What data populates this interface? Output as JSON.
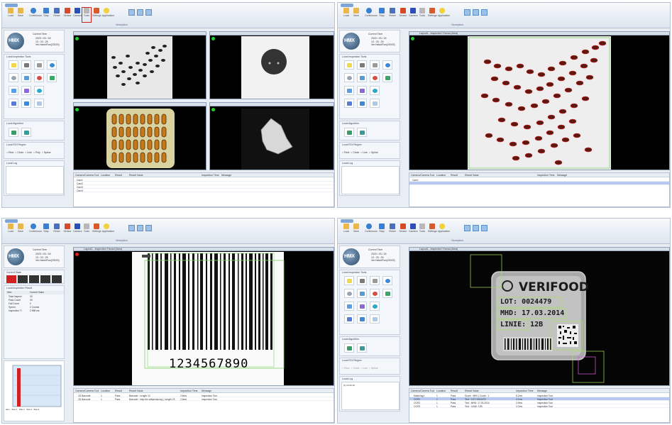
{
  "ribbon": {
    "buttons": [
      "Load",
      "Save",
      "Continuous",
      "Stop",
      "Reset",
      "Sensor",
      "Camera",
      "Tools",
      "Settings",
      "Light",
      "Application"
    ],
    "group_label": "Viewoption",
    "layout_labels": "Vertical  Horizontal  Splitter"
  },
  "panel": {
    "logo": "HMX",
    "time_label": "Current Time",
    "time_values": [
      "2020 / 03 / 18",
      "13 : 33 : 25",
      "Ver.HatchRun(20023)"
    ],
    "inspection_tools": "Local Inspection Tools",
    "algorithm": "Local Algorithm",
    "roi_region": "Local ROI Region",
    "roi_options": [
      "Rect",
      "Circle",
      "Line",
      "Poly",
      "Spline"
    ],
    "log": "Local Log",
    "log_entry": "[1] 13:33:18"
  },
  "w3panel": {
    "current_state": "Current State",
    "inspection_result": "Local Inspection Result",
    "table_headers": [
      "Item",
      "Current Value"
    ],
    "rows": [
      "Total Inspect",
      "Pass Count",
      "Fail Count",
      "Speed",
      "Inspection Ti"
    ],
    "values": [
      "30",
      "30",
      "0",
      "2 Counts",
      "2.968 ms"
    ],
    "axis_labels": [
      "Item",
      "Stat 1",
      "Stat 2",
      "Stat 3",
      "Stat 4"
    ]
  },
  "views": {
    "w2_header": "Layout1 - Inspection Thread (Area)",
    "w3_header": "Layout1 - Inspection Thread (Area)",
    "w4_header": "Layout1 - Inspection Thread (Area)"
  },
  "verifood": {
    "brand": "VERIFOOD",
    "lot": "LOT: 0024479",
    "mhd": "MHD: 17.03.2014",
    "linie": "LINIE: 12B"
  },
  "barcode": {
    "number": "1234567890"
  },
  "table": {
    "headers": [
      "Camera/Camera Tool",
      "Location",
      "Result",
      "Result Value",
      "Inspection Time",
      "Message"
    ],
    "w1_rows": [
      "Cam1",
      "Cam2",
      "Cam3",
      "Cam4"
    ],
    "w3_rows": [
      [
        "1D Barcode",
        "1",
        "Pass",
        "Barcode : Length 10",
        "2.6ms",
        "Inspection Tool"
      ],
      [
        "2D Barcode",
        "1",
        "Pass",
        "Barcode : http://en.wikipedia.org | Length 23",
        "2.6ms",
        "Inspection Tool"
      ]
    ],
    "w4_rows": [
      [
        "Matching1",
        "1",
        "Pass",
        "Score : 98% | Count : 1",
        "8.2ms",
        "Inspection Tool"
      ],
      [
        "OCR1",
        "1",
        "Pass",
        "Text : LOT: 0024479",
        "4.1ms",
        "Inspection Tool"
      ],
      [
        "OCR2",
        "1",
        "Pass",
        "Text : MHD: 17.03.2014",
        "3.9ms",
        "Inspection Tool"
      ],
      [
        "OCR3",
        "1",
        "Pass",
        "Text : LINIE: 12B",
        "3.2ms",
        "Inspection Tool"
      ]
    ]
  },
  "colors": {
    "pass": "#1fd12a",
    "fail": "#e0201a",
    "selection": "#d0201e",
    "bar": "#d31f1f"
  }
}
